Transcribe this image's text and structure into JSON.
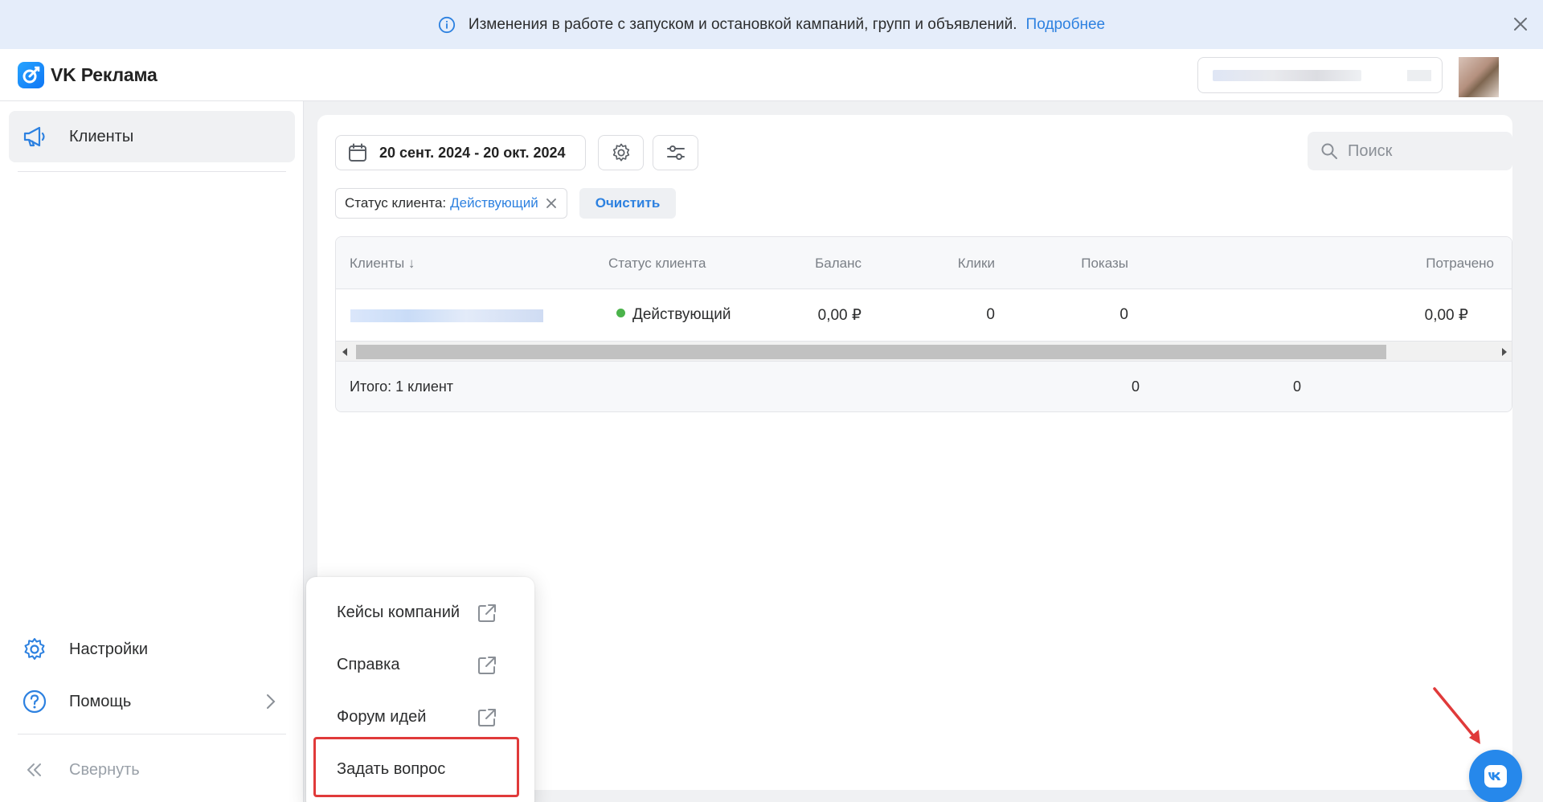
{
  "banner": {
    "text": "Изменения в работе с запуском и остановкой кампаний, групп и объявлений.",
    "link": "Подробнее"
  },
  "header": {
    "logo_text": "VK Реклама",
    "account_label": "[blurred account name]"
  },
  "sidebar": {
    "items": [
      {
        "label": "Клиенты",
        "icon": "megaphone-icon",
        "active": true
      },
      {
        "label": "Настройки",
        "icon": "gear-icon"
      },
      {
        "label": "Помощь",
        "icon": "question-icon"
      }
    ],
    "collapse_label": "Свернуть"
  },
  "toolbar": {
    "date_range": "20 сент. 2024 - 20 окт. 2024",
    "search_placeholder": "Поиск"
  },
  "filter": {
    "key": "Статус клиента:",
    "value": "Действующий",
    "clear_label": "Очистить"
  },
  "table": {
    "columns": [
      "Клиенты ↓",
      "Статус клиента",
      "Баланс",
      "Клики",
      "Показы",
      "Потрачено"
    ],
    "rows": [
      {
        "name": "[blurred client name]",
        "status": "Действующий",
        "balance": "0,00 ₽",
        "clicks": "0",
        "impressions": "0",
        "spent": "0,00 ₽"
      }
    ],
    "footer": {
      "label": "Итого: 1 клиент",
      "clicks": "0",
      "impressions": "0"
    }
  },
  "help_menu": {
    "items": [
      {
        "label": "Кейсы компаний",
        "external": true
      },
      {
        "label": "Справка",
        "external": true
      },
      {
        "label": "Форум идей",
        "external": true
      },
      {
        "label": "Задать вопрос",
        "highlighted": true
      }
    ]
  },
  "colors": {
    "accent": "#2d81e0",
    "status_active": "#4bb34b",
    "highlight": "#e03a3a",
    "chat_button": "#2688eb"
  }
}
